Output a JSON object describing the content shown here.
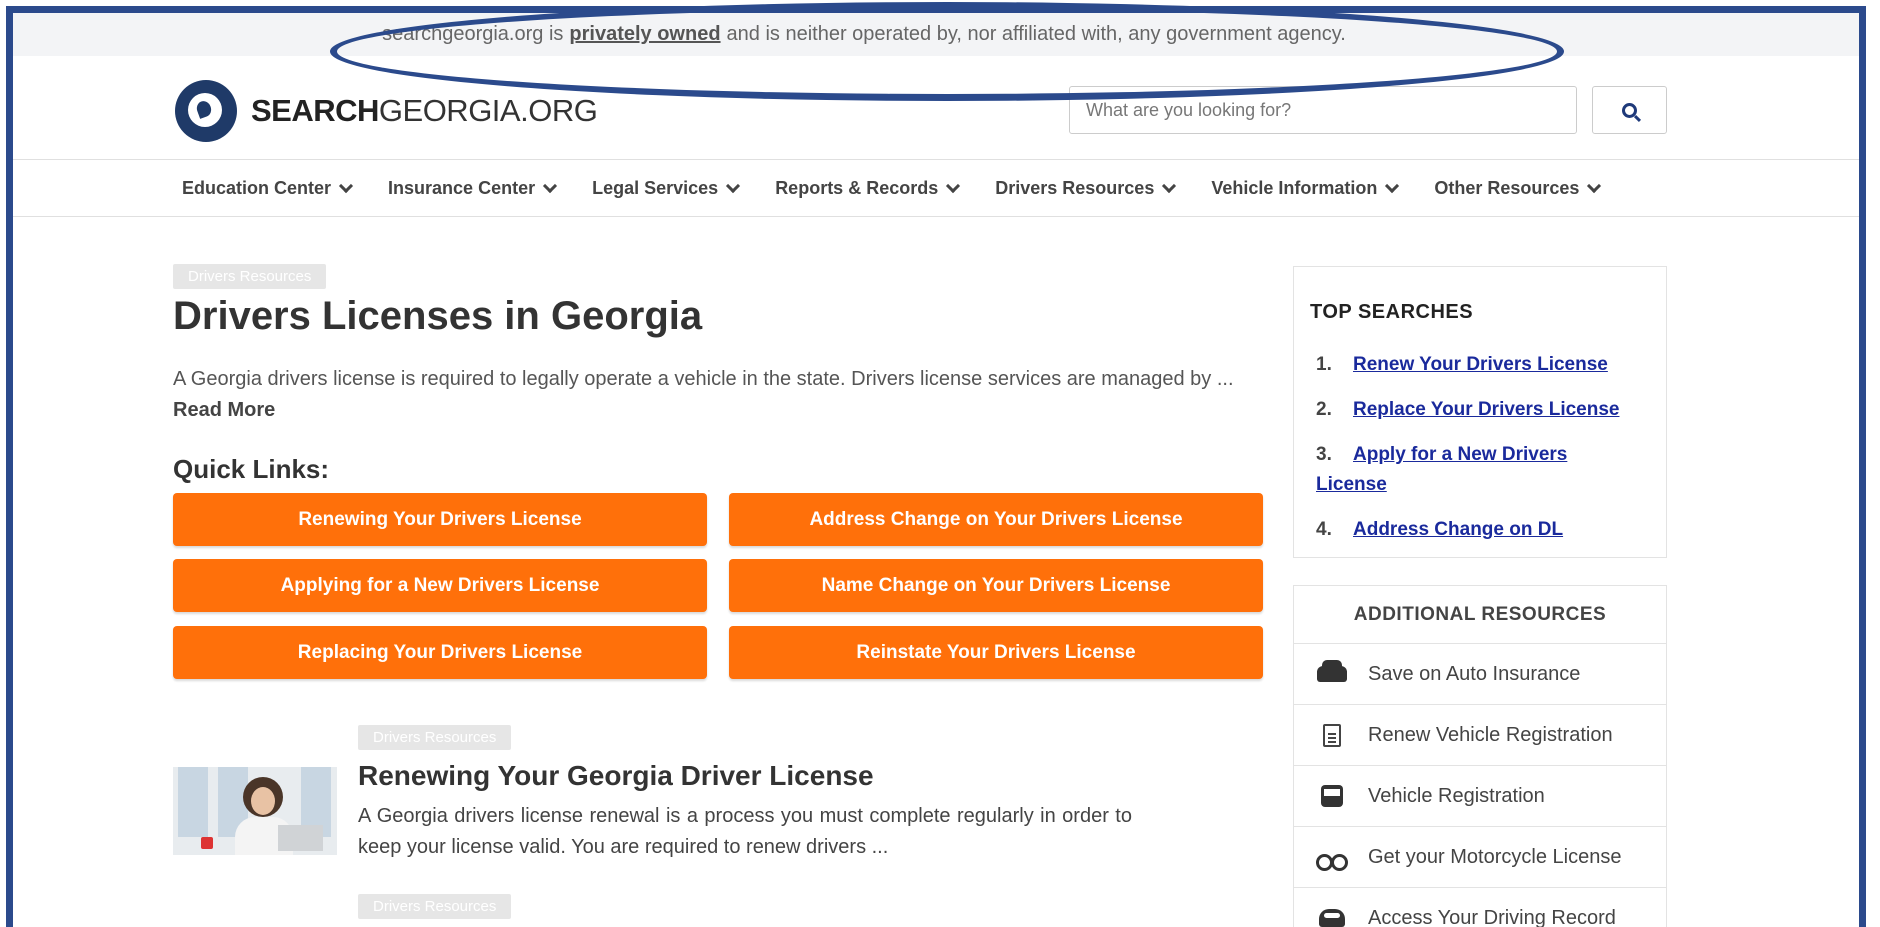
{
  "disclaimer": {
    "prefix": "searchgeorgia.org is",
    "emphasis": "privately owned",
    "suffix": "and is neither operated by, nor affiliated with, any government agency."
  },
  "header": {
    "logo_bold": "SEARCH",
    "logo_light": "GEORGIA.ORG",
    "search_placeholder": "What are you looking for?",
    "search_icon": "magnifier-icon"
  },
  "nav": {
    "items": [
      "Education Center",
      "Insurance Center",
      "Legal Services",
      "Reports & Records",
      "Drivers Resources",
      "Vehicle Information",
      "Other Resources"
    ]
  },
  "main": {
    "category_tag": "Drivers Resources",
    "title": "Drivers Licenses in Georgia",
    "intro": "A Georgia drivers license is required to legally operate a vehicle in the state. Drivers license services are managed by ...",
    "read_more": "Read More",
    "quick_links_title": "Quick Links:",
    "quick_links": [
      "Renewing Your Drivers License",
      "Address Change on Your Drivers License",
      "Applying for a New Drivers License",
      "Name Change on Your Drivers License",
      "Replacing Your Drivers License",
      "Reinstate Your Drivers License"
    ],
    "article": {
      "tag": "Drivers Resources",
      "title": "Renewing Your Georgia Driver License",
      "text": "A Georgia drivers license renewal is a process you must complete regularly in order to keep your license valid. You are required to renew drivers ..."
    },
    "next_article_tag": "Drivers Resources"
  },
  "sidebar": {
    "top_searches_title": "TOP SEARCHES",
    "top_searches": [
      {
        "num": "1.",
        "label": "Renew Your Drivers License"
      },
      {
        "num": "2.",
        "label": "Replace Your Drivers License"
      },
      {
        "num": "3.",
        "label": "Apply for a New Drivers License"
      },
      {
        "num": "4.",
        "label": "Address Change on DL"
      }
    ],
    "additional_title": "ADDITIONAL RESOURCES",
    "resources": [
      {
        "label": "Save on Auto Insurance",
        "icon": "car-icon"
      },
      {
        "label": "Renew Vehicle Registration",
        "icon": "document-icon"
      },
      {
        "label": "Vehicle Registration",
        "icon": "bus-icon"
      },
      {
        "label": "Get your Motorcycle License",
        "icon": "motorcycle-icon"
      },
      {
        "label": "Access Your Driving Record",
        "icon": "dashboard-icon"
      }
    ]
  },
  "colors": {
    "accent": "#ff700a",
    "brand": "#1f3a68",
    "link": "#1a2a9c",
    "annotation": "#2b4a8c"
  }
}
